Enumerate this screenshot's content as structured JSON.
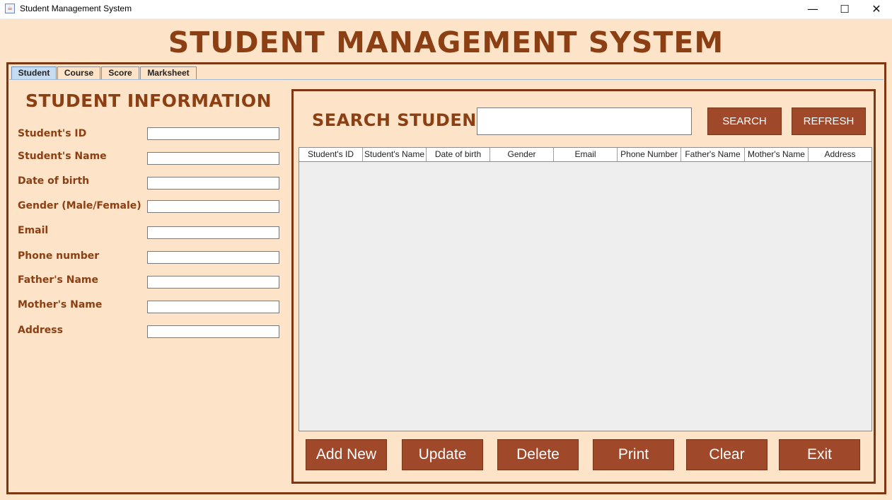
{
  "window": {
    "title": "Student Management System",
    "icon": "java-icon",
    "controls": {
      "minimize": "—",
      "maximize": "☐",
      "close": "✕"
    }
  },
  "header": {
    "title": "STUDENT MANAGEMENT SYSTEM"
  },
  "tabs": [
    {
      "label": "Student",
      "active": true
    },
    {
      "label": "Course",
      "active": false
    },
    {
      "label": "Score",
      "active": false
    },
    {
      "label": "Marksheet",
      "active": false
    }
  ],
  "student_info": {
    "title": "STUDENT INFORMATION",
    "fields": [
      {
        "label": "Student's ID",
        "value": ""
      },
      {
        "label": "Student's Name",
        "value": ""
      },
      {
        "label": "Date of birth",
        "value": ""
      },
      {
        "label": "Gender (Male/Female)",
        "value": ""
      },
      {
        "label": "Email",
        "value": ""
      },
      {
        "label": "Phone number",
        "value": ""
      },
      {
        "label": "Father's Name",
        "value": ""
      },
      {
        "label": "Mother's Name",
        "value": ""
      },
      {
        "label": "Address",
        "value": ""
      }
    ]
  },
  "search": {
    "title": "SEARCH STUDENT",
    "query": "",
    "search_label": "SEARCH",
    "refresh_label": "REFRESH"
  },
  "table": {
    "columns": [
      "Student's ID",
      "Student's Name",
      "Date of birth",
      "Gender",
      "Email",
      "Phone Number",
      "Father's Name",
      "Mother's Name",
      "Address"
    ],
    "rows": []
  },
  "actions": {
    "add_new": "Add New",
    "update": "Update",
    "delete": "Delete",
    "print": "Print",
    "clear": "Clear",
    "exit": "Exit"
  },
  "colors": {
    "background": "#fde3c8",
    "accent": "#8b3f12",
    "button": "#a0492a",
    "frame": "#7f3412"
  }
}
